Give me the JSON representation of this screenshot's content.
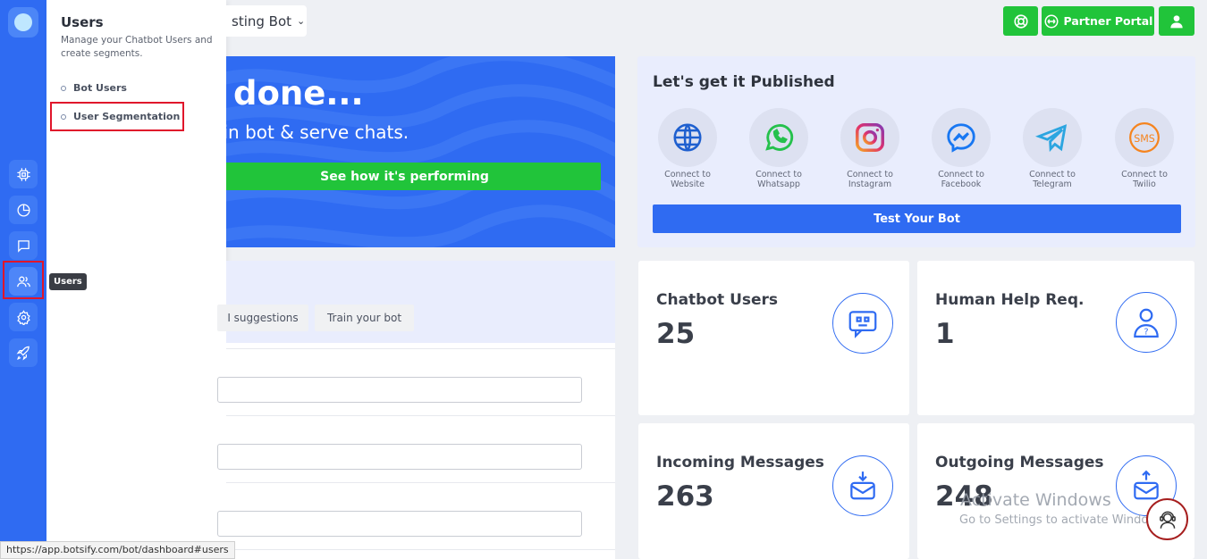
{
  "colors": {
    "brand_blue": "#2f6bf2",
    "green": "#21c43a",
    "highlight_red": "#e0162b"
  },
  "rail": {
    "items": [
      {
        "icon": "chip-icon"
      },
      {
        "icon": "pie-chart-icon"
      },
      {
        "icon": "chat-icon"
      },
      {
        "icon": "users-icon"
      },
      {
        "icon": "gear-icon"
      },
      {
        "icon": "rocket-icon"
      }
    ],
    "tooltip": "Users"
  },
  "flyout": {
    "title": "Users",
    "description": "Manage your Chatbot Users and create segments.",
    "items": [
      {
        "label": "Bot Users"
      },
      {
        "label": "User Segmentation"
      }
    ]
  },
  "topbar": {
    "bot_name": "sting Bot",
    "support_icon": "lifebuoy-icon",
    "partner_label": "Partner Portal",
    "profile_icon": "user-icon"
  },
  "hero": {
    "title": "done...",
    "subtitle": "rain bot & serve chats.",
    "button": "See how it's performing"
  },
  "publish": {
    "title": "Let's get it Published",
    "channels": [
      {
        "name": "Website",
        "line1": "Connect to",
        "line2": "Website",
        "icon": "globe-icon"
      },
      {
        "name": "Whatsapp",
        "line1": "Connect to",
        "line2": "Whatsapp",
        "icon": "whatsapp-icon"
      },
      {
        "name": "Instagram",
        "line1": "Connect to",
        "line2": "Instagram",
        "icon": "instagram-icon"
      },
      {
        "name": "Facebook",
        "line1": "Connect to",
        "line2": "Facebook",
        "icon": "messenger-icon"
      },
      {
        "name": "Telegram",
        "line1": "Connect to",
        "line2": "Telegram",
        "icon": "telegram-icon"
      },
      {
        "name": "Twilio",
        "line1": "Connect to",
        "line2": "Twilio",
        "icon": "sms-icon"
      }
    ],
    "test_button": "Test Your Bot"
  },
  "training": {
    "tabs": [
      {
        "label": "I suggestions"
      },
      {
        "label": "Train your bot"
      }
    ]
  },
  "stats": [
    {
      "label": "Chatbot Users",
      "value": "25",
      "icon": "chatbot-icon"
    },
    {
      "label": "Human Help Req.",
      "value": "1",
      "icon": "human-help-icon"
    },
    {
      "label": "Incoming Messages",
      "value": "263",
      "icon": "inbox-in-icon"
    },
    {
      "label": "Outgoing Messages",
      "value": "248",
      "icon": "inbox-out-icon"
    }
  ],
  "watermark": {
    "line1": "Activate Windows",
    "line2": "Go to Settings to activate Windows."
  },
  "status_url": "https://app.botsify.com/bot/dashboard#users"
}
